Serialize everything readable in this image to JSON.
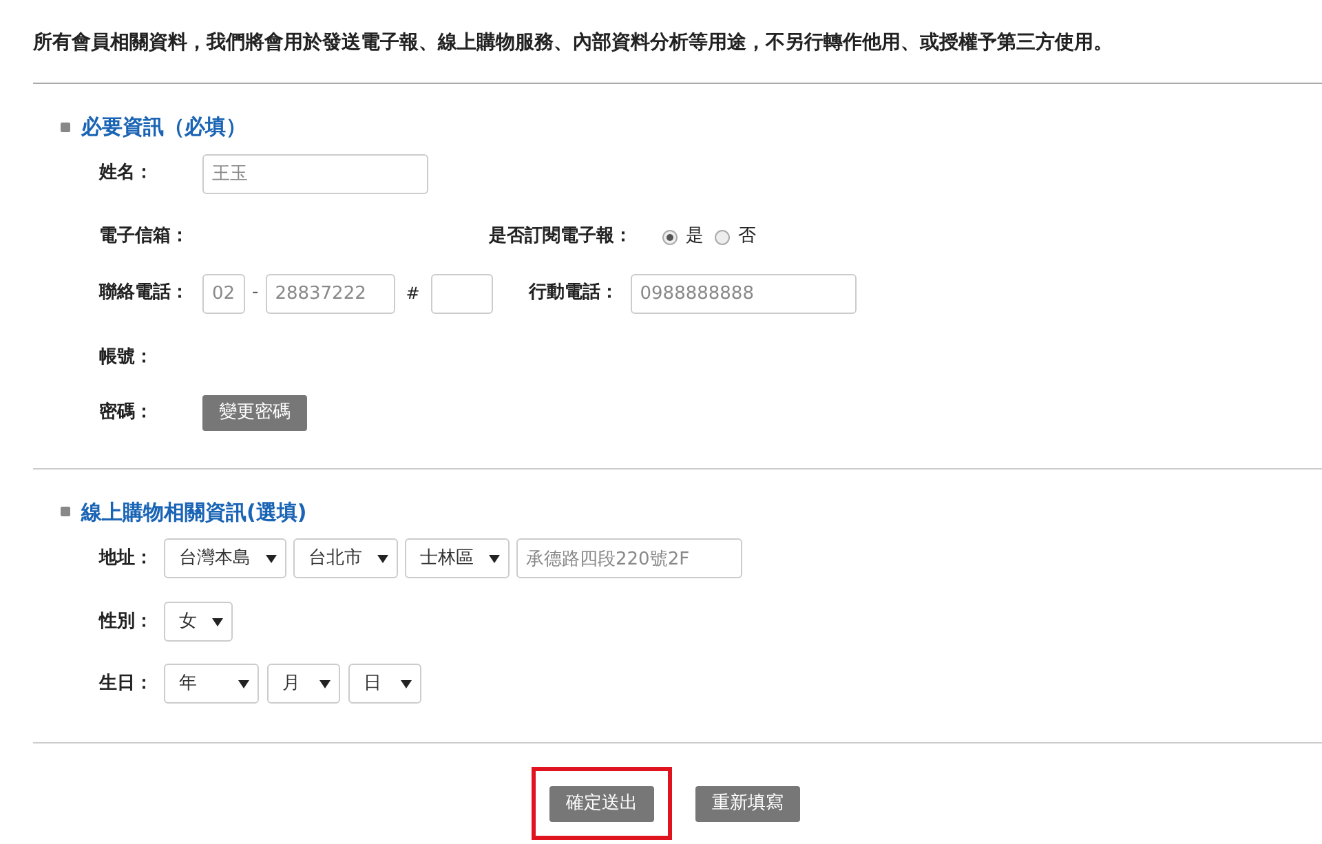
{
  "notice": "所有會員相關資料，我們將會用於發送電子報、線上購物服務、內部資料分析等用途，不另行轉作他用、或授權予第三方使用。",
  "required_section": {
    "title": "必要資訊（必填）",
    "name": {
      "label": "姓名：",
      "value": "王玉"
    },
    "email": {
      "label": "電子信箱："
    },
    "subscribe": {
      "label": "是否訂閱電子報：",
      "options": [
        {
          "label": "是",
          "selected": true
        },
        {
          "label": "否",
          "selected": false
        }
      ]
    },
    "phone": {
      "label": "聯絡電話：",
      "area": "02",
      "separator": "-",
      "number": "28837222",
      "ext_mark": "#"
    },
    "mobile": {
      "label": "行動電話：",
      "value": "0988888888"
    },
    "account": {
      "label": "帳號："
    },
    "password": {
      "label": "密碼：",
      "button": "變更密碼"
    }
  },
  "optional_section": {
    "title": "線上購物相關資訊(選填)",
    "address": {
      "label": "地址：",
      "selects": [
        "台灣本島",
        "台北市",
        "士林區"
      ],
      "street": "承德路四段220號2F"
    },
    "gender": {
      "label": "性別：",
      "select": "女"
    },
    "birthday": {
      "label": "生日：",
      "selects": [
        "年",
        "月",
        "日"
      ]
    }
  },
  "buttons": [
    {
      "label": "確定送出",
      "highlighted": true
    },
    {
      "label": "重新填寫",
      "highlighted": false
    }
  ]
}
